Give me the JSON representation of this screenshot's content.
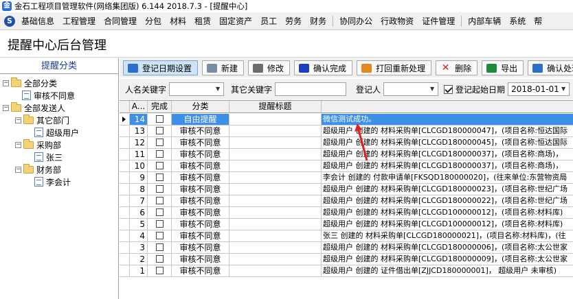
{
  "window": {
    "title": "金石工程项目管理软件(网络集团版) 6.144  2018.7.3 - [提醒中心]"
  },
  "menu": [
    "基础信息",
    "工程管理",
    "合同管理",
    "分包",
    "材料",
    "租赁",
    "固定资产",
    "员工",
    "劳务",
    "财务",
    "协同办公",
    "行政物资",
    "证件管理",
    "内部车辆",
    "系统",
    "帮"
  ],
  "page": {
    "title": "提醒中心后台管理"
  },
  "left_panel": {
    "header": "提醒分类",
    "tree": [
      {
        "label": "全部分类",
        "type": "folder",
        "level": 0
      },
      {
        "label": "审核不同意",
        "type": "doc",
        "level": 1
      },
      {
        "label": "全部发送人",
        "type": "folder",
        "level": 0
      },
      {
        "label": "其它部门",
        "type": "folder",
        "level": 1
      },
      {
        "label": "超级用户",
        "type": "doc",
        "level": 2
      },
      {
        "label": "采购部",
        "type": "folder",
        "level": 1
      },
      {
        "label": "张三",
        "type": "doc",
        "level": 2
      },
      {
        "label": "财务部",
        "type": "folder",
        "level": 1
      },
      {
        "label": "李会计",
        "type": "doc",
        "level": 2
      }
    ]
  },
  "toolbar": {
    "buttons": [
      {
        "label": "登记日期设置",
        "icon": "calendar-settings-icon",
        "color": "#2a6fc9"
      },
      {
        "label": "新建",
        "icon": "new-document-icon",
        "color": "#7a8da8"
      },
      {
        "label": "修改",
        "icon": "edit-icon",
        "color": "#6b6b6b"
      },
      {
        "label": "确认完成",
        "icon": "confirm-icon",
        "color": "#1b3fbf"
      },
      {
        "label": "打回重新处理",
        "icon": "return-icon",
        "color": "#e3891d"
      },
      {
        "label": "删除",
        "icon": "delete-icon",
        "color": "#d42020"
      },
      {
        "label": "导出",
        "icon": "excel-export-icon",
        "color": "#1e8a3c"
      },
      {
        "label": "确认处理",
        "icon": "confirm-process-icon",
        "color": "#2a6fc9"
      }
    ]
  },
  "filters": {
    "person_label": "人名关键字",
    "other_label": "其它关键字",
    "registrant_label": "登记人",
    "start_date_label": "登记起始日期",
    "start_date_checked": true,
    "start_date": "2018-01-01"
  },
  "grid": {
    "columns": [
      "A...",
      "完成",
      "分类",
      "提醒标题",
      ""
    ],
    "rows": [
      {
        "id": "14",
        "category": "自由提醒",
        "title": "微信测试成功。",
        "selected": true
      },
      {
        "id": "13",
        "category": "审核不同意",
        "title": "超级用户 创建的 材料采购单[CLCGD180000047]，(项目名称:恒达国际"
      },
      {
        "id": "12",
        "category": "审核不同意",
        "title": "超级用户 创建的 材料采购单[CLCGD180000045]，(项目名称:恒达国际"
      },
      {
        "id": "11",
        "category": "审核不同意",
        "title": "超级用户 创建的 材料采购单[CLCGD180000037]，(项目名称:商场)，"
      },
      {
        "id": "10",
        "category": "审核不同意",
        "title": "超级用户 创建的 材料采购单[CLCGD180000037]，(项目名称:商场)，"
      },
      {
        "id": "9",
        "category": "审核不同意",
        "title": "李会计 创建的 付款申请单[FKSQD180000020]，(往来单位:东营物资局"
      },
      {
        "id": "8",
        "category": "审核不同意",
        "title": "超级用户 创建的 材料采购单[CLCGD180000023]，(项目名称:世纪广场"
      },
      {
        "id": "7",
        "category": "审核不同意",
        "title": "超级用户 创建的 材料采购单[CLCGD180000022]，(项目名称:世纪广场"
      },
      {
        "id": "6",
        "category": "审核不同意",
        "title": "超级用户 创建的 材料采购单[CLCGD100000012]，(项目名称:材料库)"
      },
      {
        "id": "5",
        "category": "审核不同意",
        "title": "超级用户 创建的 材料采购单[CLCGD100000012]，(项目名称:材料库)"
      },
      {
        "id": "4",
        "category": "审核不同意",
        "title": "张三 创建的 材料采购单[CLCGD180000021]，(项目名称:材料库)，(往"
      },
      {
        "id": "3",
        "category": "审核不同意",
        "title": "超级用户 创建的 材料采购单[CLCGD180000006]，(项目名称:太公世家"
      },
      {
        "id": "2",
        "category": "审核不同意",
        "title": "超级用户 创建的 材料采购单[CLCGD180000009]，(项目名称:太公世家"
      },
      {
        "id": "1",
        "category": "审核不同意",
        "title": "超级用户 创建的 证件借出单[ZJJCD180000001]， 超级用户 未审核)"
      }
    ]
  }
}
